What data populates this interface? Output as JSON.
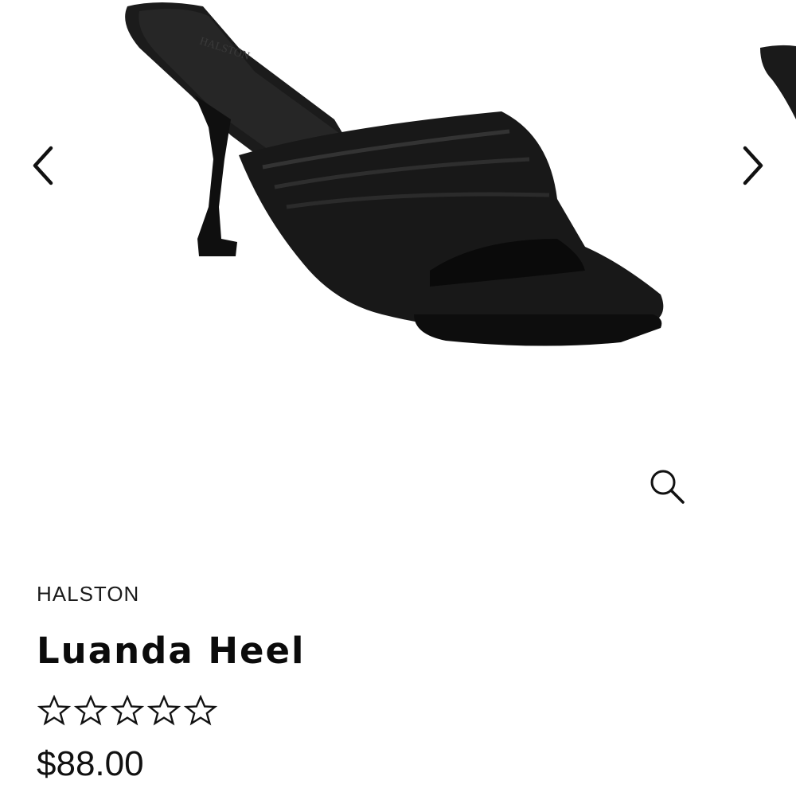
{
  "product": {
    "brand": "HALSTON",
    "name": "Luanda Heel",
    "price": "$88.00",
    "rating": {
      "value": 0,
      "max": 5
    }
  },
  "gallery": {
    "prev_icon": "chevron-left-icon",
    "next_icon": "chevron-right-icon",
    "zoom_icon": "magnifier-icon"
  },
  "colors": {
    "shoe": "#141414",
    "background": "#ffffff",
    "text": "#111111"
  }
}
